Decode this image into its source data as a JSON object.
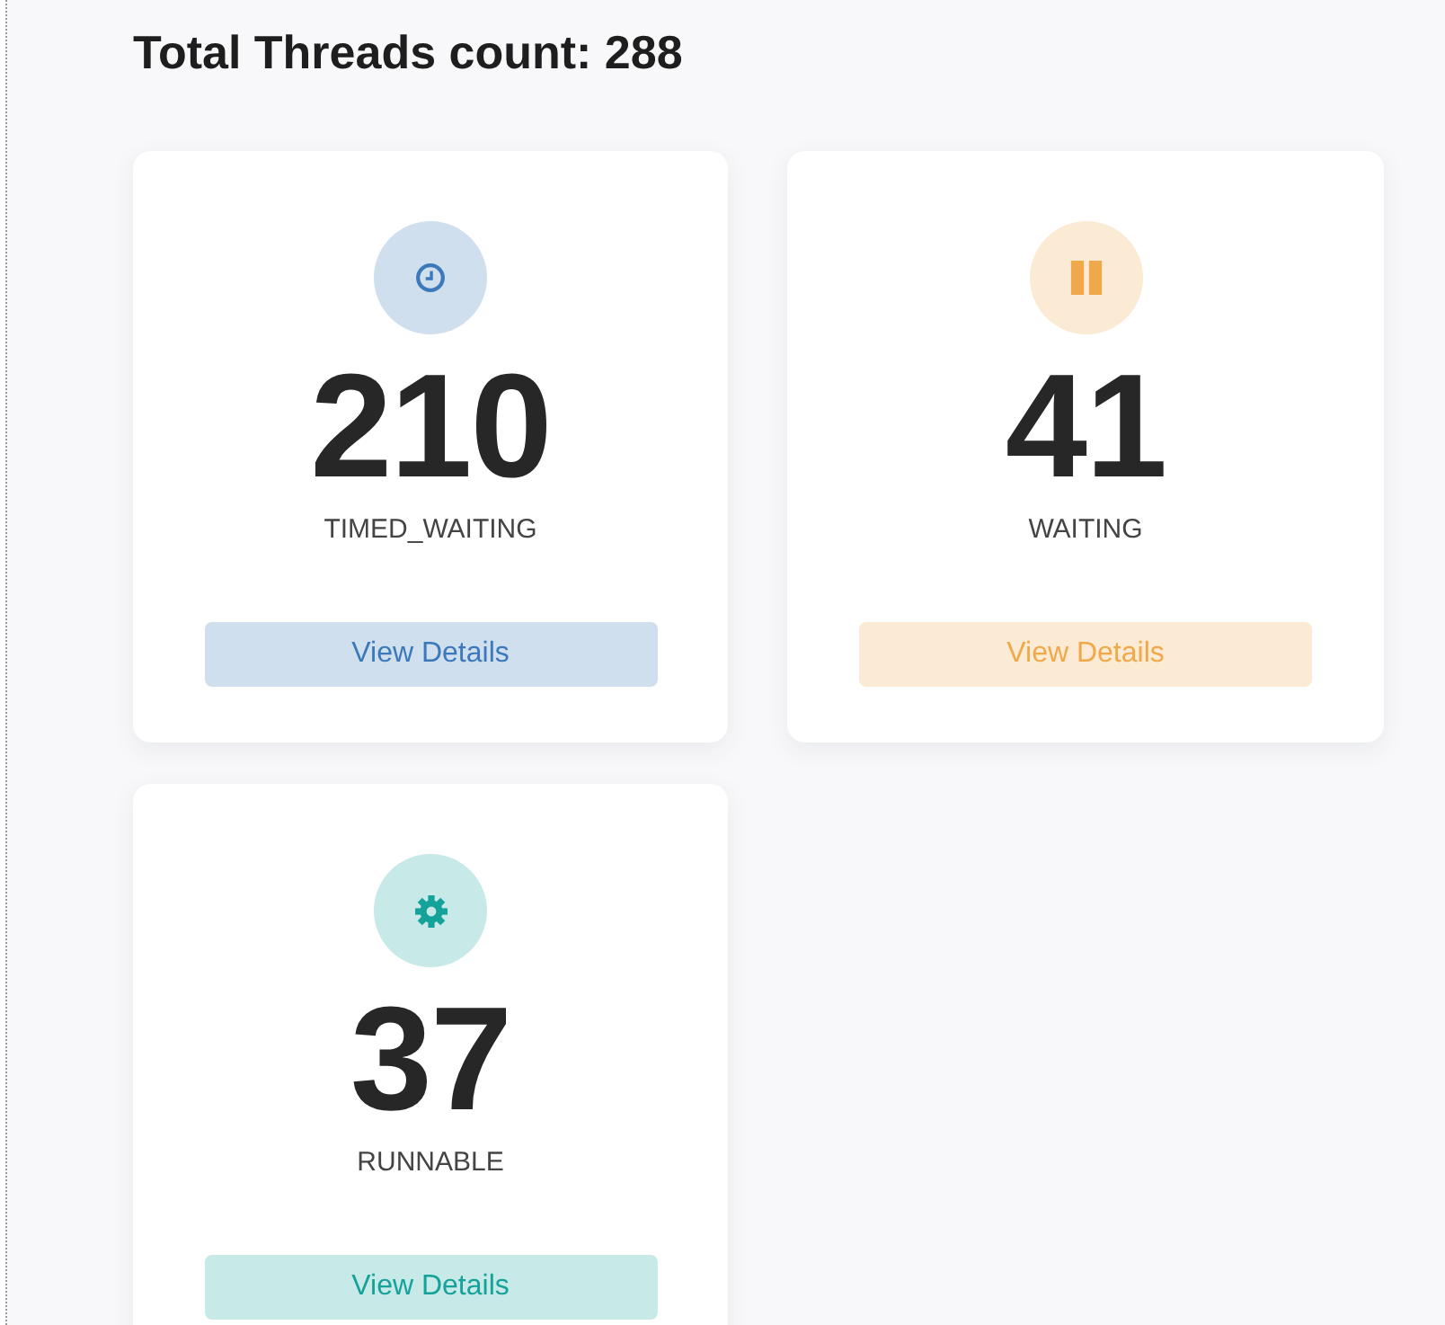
{
  "title": "Total Threads count: 288",
  "cards": [
    {
      "kind": "clock",
      "count": "210",
      "state": "TIMED_WAITING",
      "button": "View Details",
      "color": "#3b79ba"
    },
    {
      "kind": "pause",
      "count": "41",
      "state": "WAITING",
      "button": "View Details",
      "color": "#f0a94a"
    },
    {
      "kind": "gear",
      "count": "37",
      "state": "RUNNABLE",
      "button": "View Details",
      "color": "#15a29a"
    }
  ]
}
